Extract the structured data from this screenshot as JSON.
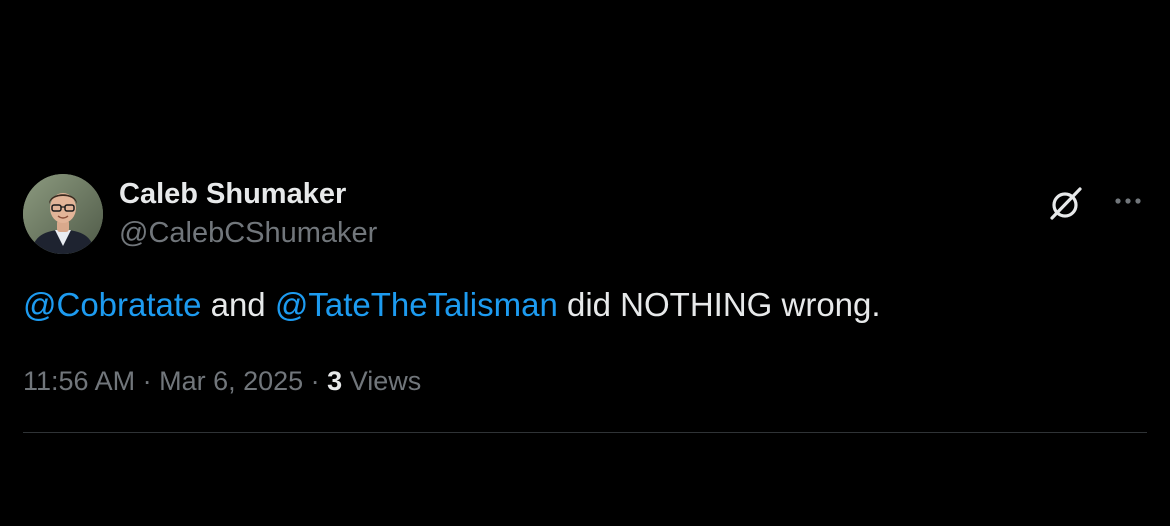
{
  "author": {
    "display_name": "Caleb Shumaker",
    "handle": "@CalebCShumaker"
  },
  "tweet": {
    "mention_1": "@Cobratate",
    "connector": " and ",
    "mention_2": "@TateTheTalisman",
    "rest": " did NOTHING wrong."
  },
  "meta": {
    "time": "11:56 AM",
    "sep_1": " · ",
    "date": "Mar 6, 2025",
    "sep_2": " · ",
    "views_count": "3",
    "views_label": " Views"
  },
  "icons": {
    "grok": "grok-icon",
    "more": "more-options-icon",
    "avatar": "avatar"
  },
  "colors": {
    "background": "#000000",
    "text": "#e7e9ea",
    "secondary": "#71767b",
    "link": "#1d9bf0",
    "divider": "#2f3336"
  }
}
